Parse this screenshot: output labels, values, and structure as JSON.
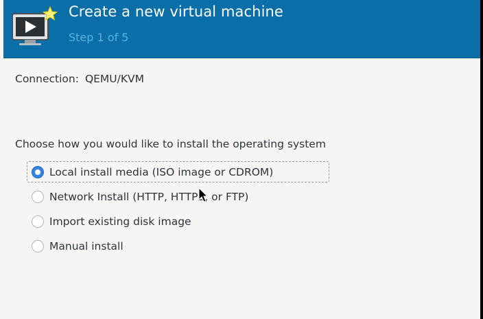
{
  "header": {
    "title": "Create a new virtual machine",
    "subtitle": "Step 1 of 5",
    "icon": "virtual-machine-new-icon"
  },
  "connection": {
    "label": "Connection:",
    "value": "QEMU/KVM"
  },
  "install": {
    "question": "Choose how you would like to install the operating system",
    "options": [
      {
        "label": "Local install media (ISO image or CDROM)",
        "selected": true
      },
      {
        "label": "Network Install (HTTP, HTTPS, or FTP)",
        "selected": false
      },
      {
        "label": "Import existing disk image",
        "selected": false
      },
      {
        "label": "Manual install",
        "selected": false
      }
    ]
  },
  "colors": {
    "header_bg": "#0a6ea8",
    "subtitle": "#58b2e6",
    "radio_selected": "#3584e4",
    "body_bg": "#f6f5f4"
  }
}
